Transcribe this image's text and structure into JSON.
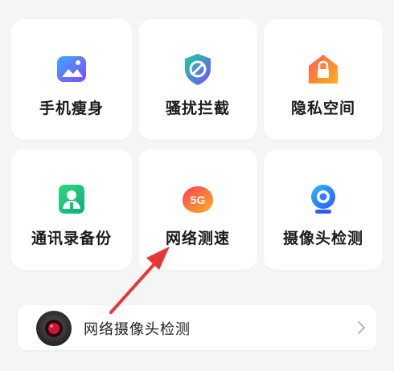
{
  "tools": {
    "row1": [
      {
        "label": "手机瘦身",
        "icon": "phone-clean-icon"
      },
      {
        "label": "骚扰拦截",
        "icon": "block-shield-icon"
      },
      {
        "label": "隐私空间",
        "icon": "privacy-lock-icon"
      }
    ],
    "row2": [
      {
        "label": "通讯录备份",
        "icon": "contacts-backup-icon"
      },
      {
        "label": "网络测速",
        "icon": "5g-speed-icon",
        "badge": "5G"
      },
      {
        "label": "摄像头检测",
        "icon": "camera-check-icon"
      }
    ]
  },
  "bottom_item": {
    "label": "网络摄像头检测",
    "icon": "webcam-icon",
    "chevron": "chevron-right-icon"
  },
  "annotation": {
    "type": "arrow",
    "color": "#e53935"
  }
}
